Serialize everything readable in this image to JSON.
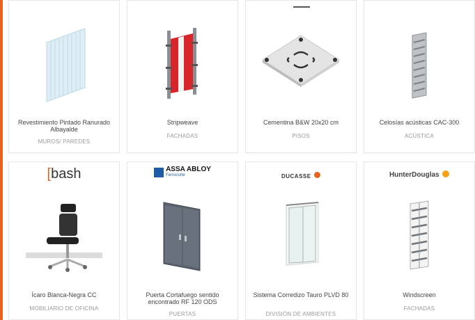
{
  "products": [
    {
      "title": "Revestimiento Pintado Ranurado Albayalde",
      "category": "MUROS/ PAREDES",
      "illustration": "ribbed-panel"
    },
    {
      "title": "Stripweave",
      "category": "FACHADAS",
      "illustration": "stripweave-panel"
    },
    {
      "title": "Cementina B&W 20x20 cm",
      "category": "PISOS",
      "illustration": "floor-tile"
    },
    {
      "title": "Celosías acústicas CAC-300",
      "category": "ACÚSTICA",
      "illustration": "acoustic-louver"
    },
    {
      "title": "Ícaro Blanca-Negra CC",
      "category": "MOBILIARIO DE OFICINA",
      "brand": "bash",
      "illustration": "office-chair"
    },
    {
      "title": "Puerta Cortafuego sentido encontrado RF 120 ODS",
      "category": "PUERTAS",
      "brand": "ASSA ABLOY",
      "brand_sub": "Ferrocorte",
      "illustration": "fire-door"
    },
    {
      "title": "Sistema Corredizo Tauro PLVD 80",
      "category": "DIVISIÓN DE AMBIENTES",
      "brand": "DUCASSE",
      "illustration": "sliding-door"
    },
    {
      "title": "Windscreen",
      "category": "FACHADAS",
      "brand": "HunterDouglas",
      "illustration": "windscreen-louver"
    }
  ],
  "colors": {
    "accent": "#e8641e",
    "red": "#d7252b",
    "brand_blue": "#1f5ca8"
  }
}
